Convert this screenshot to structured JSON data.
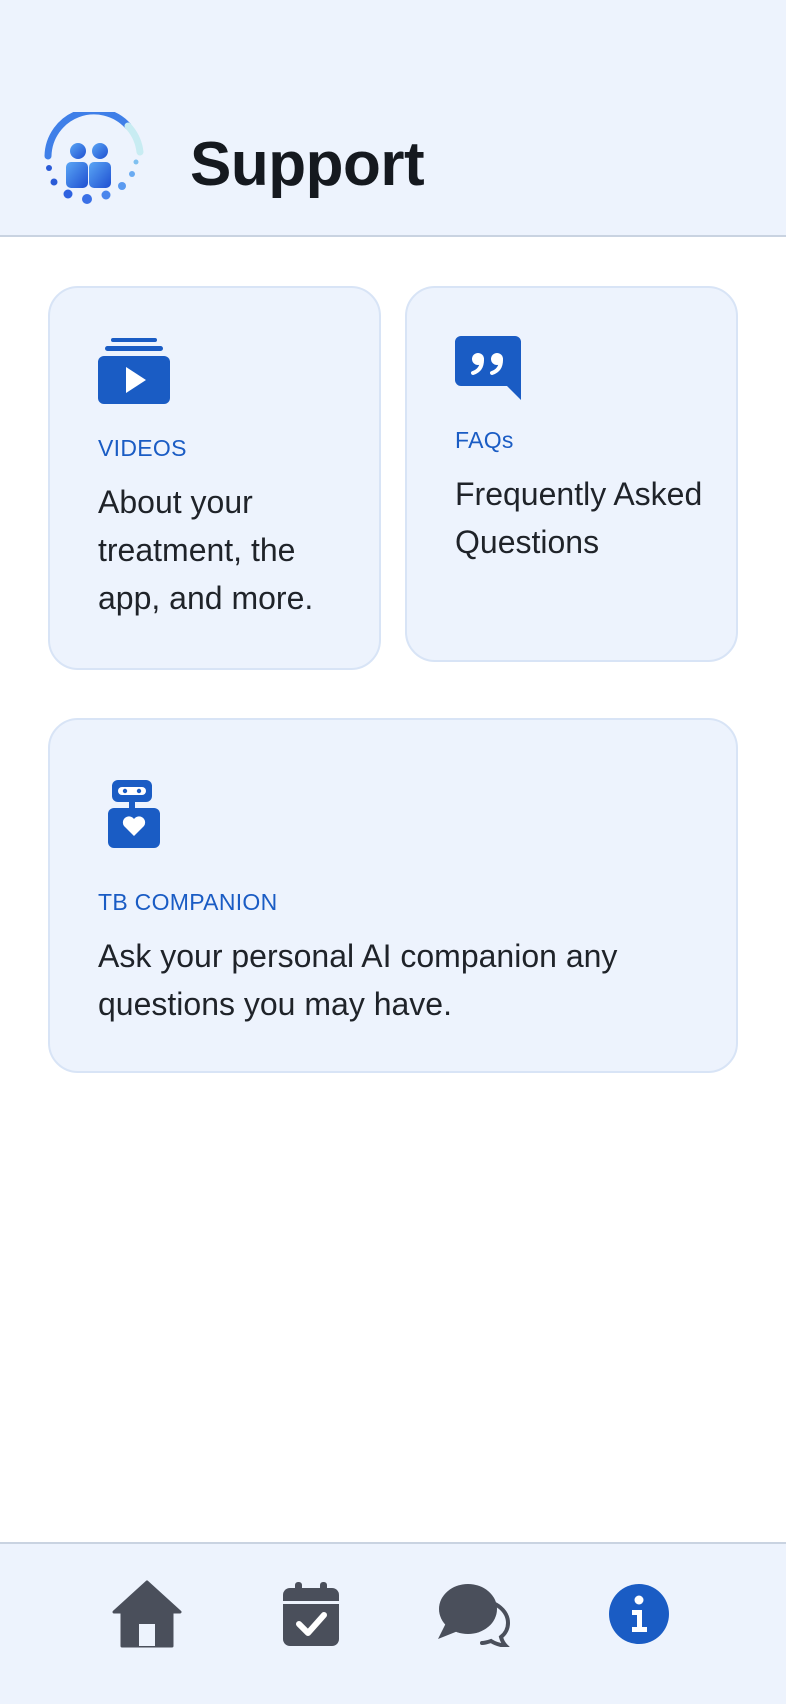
{
  "header": {
    "title": "Support",
    "logo_icon": "people-group-logo-icon"
  },
  "cards": [
    {
      "icon": "video-library-icon",
      "tag": "VIDEOS",
      "description": "About your treatment, the app, and more."
    },
    {
      "icon": "quote-bubble-icon",
      "tag": "FAQs",
      "description": "Frequently Asked Questions"
    },
    {
      "icon": "robot-heart-icon",
      "tag": "TB COMPANION",
      "description": "Ask your personal AI companion any questions you may have."
    }
  ],
  "bottom_nav": {
    "items": [
      {
        "icon": "home-icon",
        "active": false
      },
      {
        "icon": "calendar-check-icon",
        "active": false
      },
      {
        "icon": "chat-bubbles-icon",
        "active": false
      },
      {
        "icon": "info-icon",
        "active": true
      }
    ]
  },
  "colors": {
    "accent": "#1a5cc4",
    "header_bg": "#edf3fd",
    "card_bg": "#edf3fd",
    "nav_icon": "#4a4f5b"
  }
}
